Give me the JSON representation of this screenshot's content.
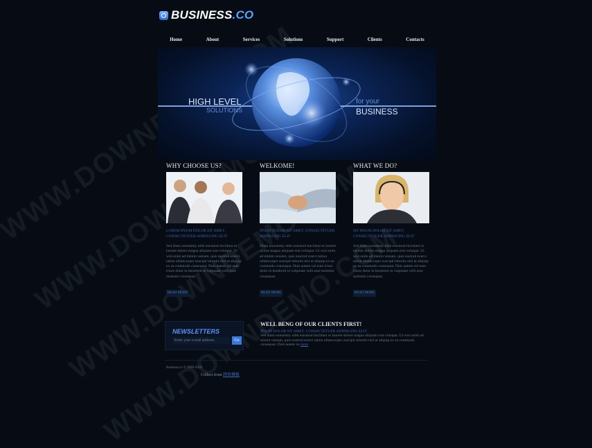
{
  "brand": {
    "name": "BUSINESS",
    "suffix": ".CO"
  },
  "nav": [
    "Home",
    "About",
    "Services",
    "Solutions",
    "Support",
    "Clients",
    "Contacts"
  ],
  "hero": {
    "left_main": "HIGH LEVEL",
    "left_sub": "SOLUTIONS",
    "right_small": "for your",
    "right_main": "BUSINESS"
  },
  "columns": [
    {
      "title": "WHY CHOOSE US?",
      "subtitle": "LOREM IPSUM DOLOR SIT AMET, CONSECTETUER ADIPISCING ELIT",
      "text": "Sed diam nonummy nibh euismod tincidunt ut laoreet dolore magna aliquam erat volutpat. Ut wisi enim ad minim veniam, quis nostrud exerci tation ullamcorper suscipit lobortis nisl ut aliquip ex ea commodo consequat. Duis autem vel eum iriure dolor in hendrerit in vulputate velit esse molestie consequat.",
      "more": "READ MORE"
    },
    {
      "title": "WELKOME!",
      "subtitle": "IPSUM DOLOR SIT AMET, CONSECTETUER ADIPISCING ELIT",
      "text": "Diam nonummy nibh euismod tincidunt ut laoreet dolore magna aliquam erat volutpat. Ut wisi enim ad minim veniam, quis nostrud exerci tation ullamcorper suscipit lobortis nisl ut aliquip ex ea commodo consequat. Duis autem vel eum iriure dolor in hendrerit in vulputate velit esse molestie consequat.",
      "more": "READ MORE"
    },
    {
      "title": "WHAT WE DO?",
      "subtitle": "SIT IPSUM DOLOR SIT AMET, CONSECTETUER ADIPISCING ELIT",
      "text": "Sed diam nonummy nibh euismod tincidunt ut laoreet dolore magna aliquam erat volutpat. Ut wisi enim ad minim veniam, quis nostrud exerci tation ullamcorper suscipit lobortis nisl ut aliquip ex ea commodo consequat. Duis autem vel eum iriure dolor in hendrerit in vulputate velit esse molestie consequat.",
      "more": "READ MORE"
    }
  ],
  "newsletter": {
    "title": "NEWSLETTERS",
    "placeholder": "Enter your e-mail address",
    "button": "Go"
  },
  "clients": {
    "title": "WELL BENG OF OUR CLIENTS FIRST!",
    "subtitle": "IPSUM DOLOR SIT AMET, CONSECTETUER ADIPISCING ELIT",
    "text": "Sed diam nonummy nibh euismod tincidunt ut laoreet dolore magna aliquam erat volutpat. Ut wisi enim ad minim veniam, quis nostrud exerci tation ullamcorper suscipit lobortis nisl ut aliquip ex ea commodo consequat. Duis autem va",
    "more": "more"
  },
  "footer": {
    "copyright": "Business.co © 2009-2010",
    "collect_prefix": "Collect from",
    "collect_link": "网页模板"
  },
  "watermark": "WWW.DOWNDEMO.COM",
  "colors": {
    "background": "#070c14",
    "accent": "#3d64b3",
    "brand_blue": "#5da0ff"
  }
}
